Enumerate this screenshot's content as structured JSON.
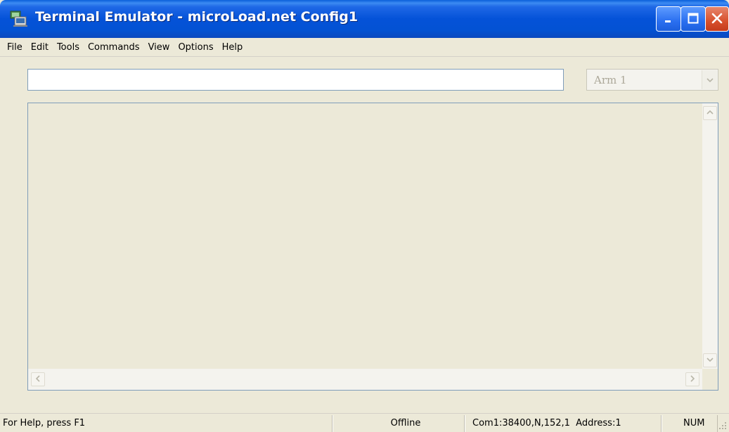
{
  "window": {
    "title": "Terminal Emulator - microLoad.net Config1"
  },
  "menu": [
    {
      "label": "File"
    },
    {
      "label": "Edit"
    },
    {
      "label": "Tools"
    },
    {
      "label": "Commands"
    },
    {
      "label": "View"
    },
    {
      "label": "Options"
    },
    {
      "label": "Help"
    }
  ],
  "command": {
    "input_value": "",
    "arm_selected": "Arm 1"
  },
  "output": {
    "text": ""
  },
  "status": {
    "help": "For Help, press F1",
    "state": "Offline",
    "connection": "Com1:38400,N,152,1  Address:1",
    "numlock": "NUM"
  },
  "colors": {
    "titlebar": "#0452d8",
    "close_button": "#d8502c",
    "window_bg": "#ece9d8"
  },
  "icons": {
    "app": "terminal-icon",
    "minimize": "minimize-icon",
    "maximize": "maximize-icon",
    "close": "close-icon"
  }
}
